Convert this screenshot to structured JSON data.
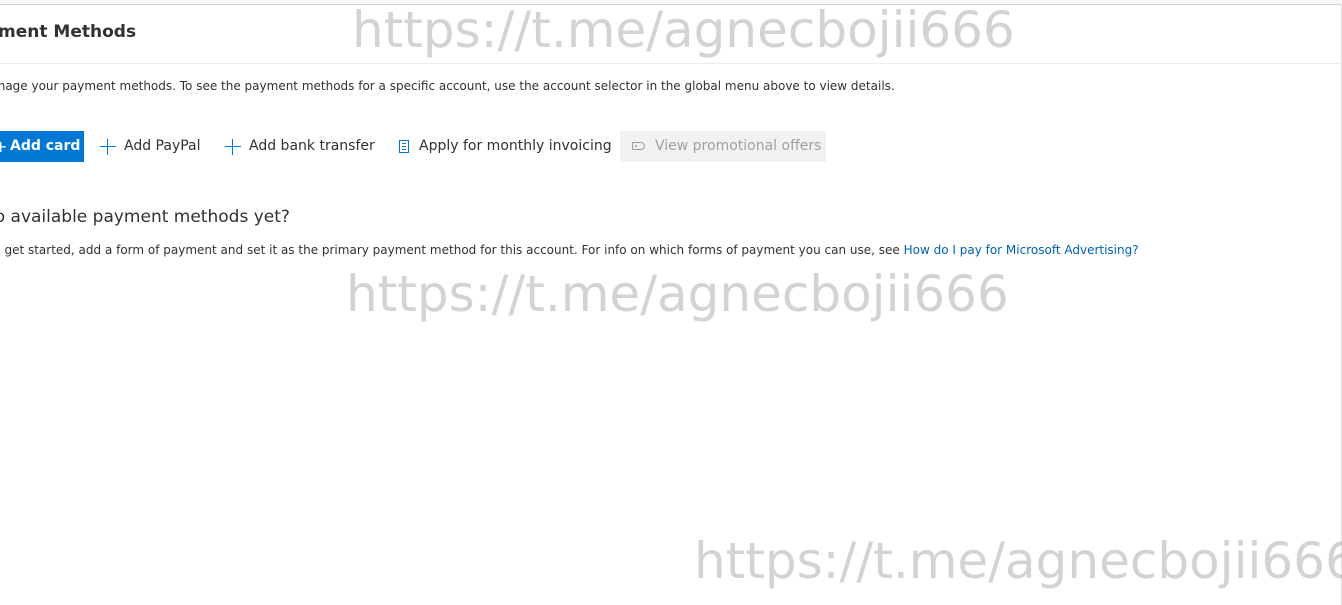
{
  "page": {
    "title": "Payment Methods",
    "description": "Manage your payment methods. To see the payment methods for a specific account, use the account selector in the global menu above to view details."
  },
  "toolbar": {
    "add_card_label": "Add card",
    "add_paypal_label": "Add PayPal",
    "add_bank_transfer_label": "Add bank transfer",
    "apply_invoicing_label": "Apply for monthly invoicing",
    "view_offers_label": "View promotional offers"
  },
  "empty_state": {
    "heading": "No available payment methods yet?",
    "text": "To get started, add a form of payment and set it as the primary payment method for this account. For info on which forms of payment you can use, see ",
    "link_text": "How do I pay for Microsoft Advertising?"
  },
  "watermark": {
    "text": "https://t.me/agnecbojii666"
  },
  "colors": {
    "accent": "#0078d4",
    "link": "#0063b1",
    "disabled_bg": "#f3f2f1",
    "disabled_text": "#a19f9d"
  }
}
